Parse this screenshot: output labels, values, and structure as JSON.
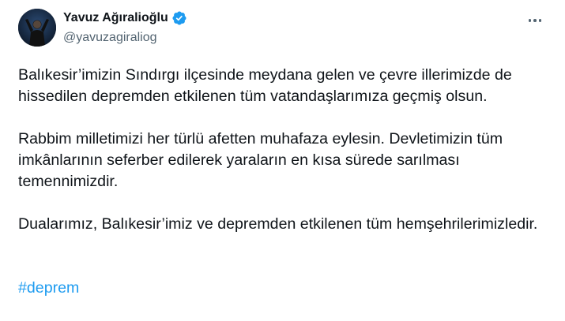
{
  "author": {
    "display_name": "Yavuz Ağıralioğlu",
    "handle": "@yavuzagiraliog",
    "verified": true,
    "avatar": "profile-photo"
  },
  "icons": {
    "verified": "verified-badge-icon",
    "more": "more-options-icon"
  },
  "colors": {
    "text": "#0f1419",
    "secondary": "#536471",
    "accent": "#1d9bf0"
  },
  "tweet": {
    "paragraphs": [
      "Balıkesir’imizin Sındırgı ilçesinde meydana gelen ve çevre illerimizde de hissedilen depremden etkilenen tüm vatandaşlarımıza geçmiş olsun.",
      "Rabbim milletimizi her türlü afetten muhafaza eylesin. Devletimizin tüm imkânlarının seferber edilerek yaraların en kısa sürede sarılması temennimizdir.",
      "Dualarımız, Balıkesir’imiz ve depremden etkilenen tüm hemşehrilerimizledir."
    ],
    "hashtag": "#deprem"
  }
}
